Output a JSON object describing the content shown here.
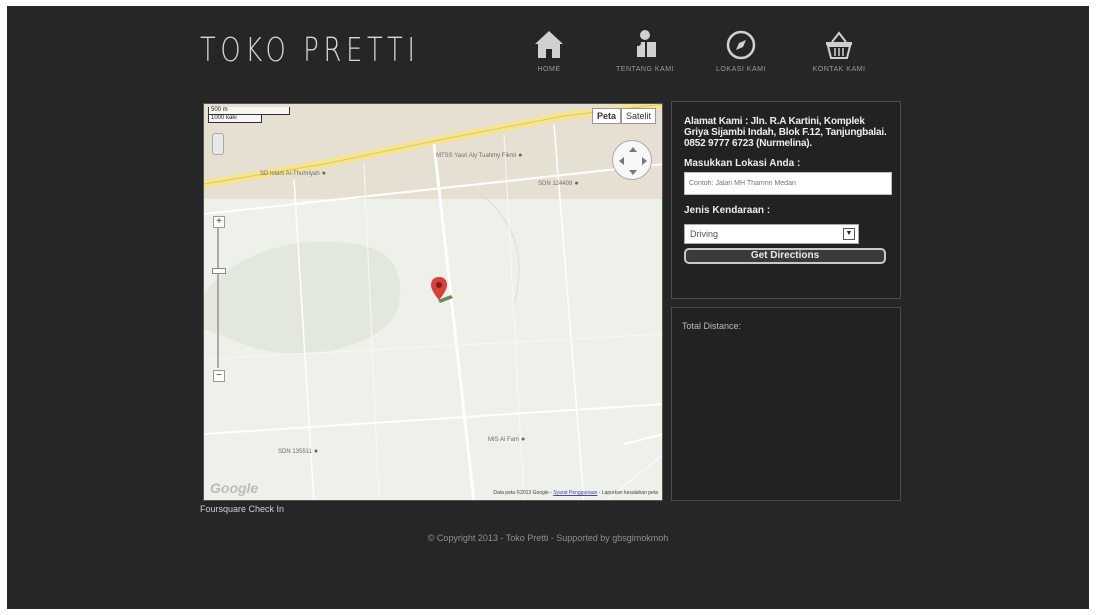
{
  "site": {
    "logo_text": "TOKO PRETTI"
  },
  "nav": [
    {
      "label": "HOME",
      "icon": "home-icon"
    },
    {
      "label": "TENTANG KAMI",
      "icon": "people-icon"
    },
    {
      "label": "LOKASI KAMI",
      "icon": "compass-icon"
    },
    {
      "label": "KONTAK KAMI",
      "icon": "basket-icon"
    }
  ],
  "map": {
    "type_buttons": [
      "Peta",
      "Satelit"
    ],
    "scale": [
      "500 m",
      "1000 kaki"
    ],
    "poi": [
      "SD Islam Al-Thuhriyah",
      "MTSS Yasri Aly Tuahmy Fikmi",
      "SDN 124409",
      "SDN 135511",
      "MIS Al Fam"
    ],
    "watermark": "Google",
    "attribution_prefix": "Data peta ©2013 Google - ",
    "attribution_link": "Syarat Penggunaan",
    "attribution_suffix": " - Laporkan kesalahan peta"
  },
  "directions": {
    "address": "Alamat Kami : Jln. R.A Kartini, Komplek Griya Sijambi Indah, Blok F.12, Tanjungbalai. 0852 9777 6723 (Nurmelina).",
    "location_label": "Masukkan Lokasi Anda :",
    "location_placeholder": "Contoh: Jalan MH Thamrin Medan",
    "vehicle_label": "Jenis Kendaraan :",
    "vehicle_selected": "Driving",
    "button_label": "Get Directions",
    "total_label": "Total Distance:"
  },
  "footer": {
    "foursquare": "Foursquare Check In",
    "copyright": "© Copyright 2013 - Toko Pretti - Supported by gbsgimokmoh"
  }
}
